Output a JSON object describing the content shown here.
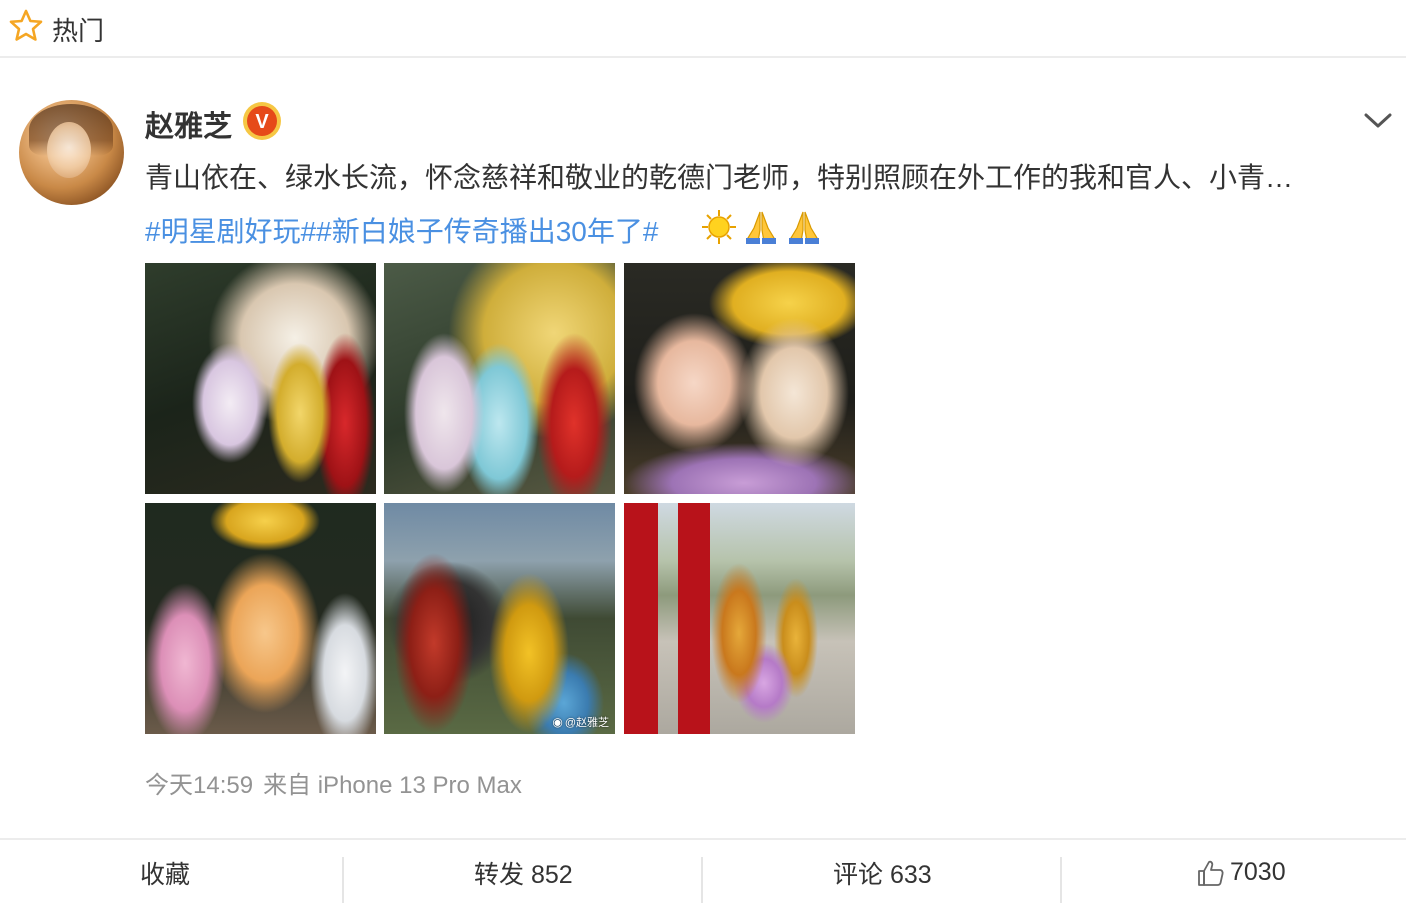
{
  "header": {
    "title": "热门",
    "icon": "star-outline-icon"
  },
  "post": {
    "author": {
      "name": "赵雅芝",
      "verified_badge": "V",
      "avatar_icon": "avatar"
    },
    "text": "青山依在、绿水长流，怀念慈祥和敬业的乾德门老师，特别照顾在外工作的我和官人、小青…",
    "topics": "#明星剧好玩##新白娘子传奇播出30年了#",
    "emojis": [
      "🌞",
      "🙏",
      "🙏"
    ],
    "photos": [
      {
        "name": "photo-1"
      },
      {
        "name": "photo-2"
      },
      {
        "name": "photo-3"
      },
      {
        "name": "photo-4"
      },
      {
        "name": "photo-5",
        "watermark": "@赵雅芝"
      },
      {
        "name": "photo-6"
      }
    ],
    "time": "今天14:59",
    "source": "来自 iPhone 13 Pro Max"
  },
  "actions": {
    "collect_label": "收藏",
    "repost_label": "转发 852",
    "comment_label": "评论 633",
    "like_count": "7030"
  },
  "colors": {
    "accent_orange": "#f5a623",
    "topic_blue": "#4a90e2",
    "meta_gray": "#939393",
    "badge_red": "#e64a19"
  }
}
